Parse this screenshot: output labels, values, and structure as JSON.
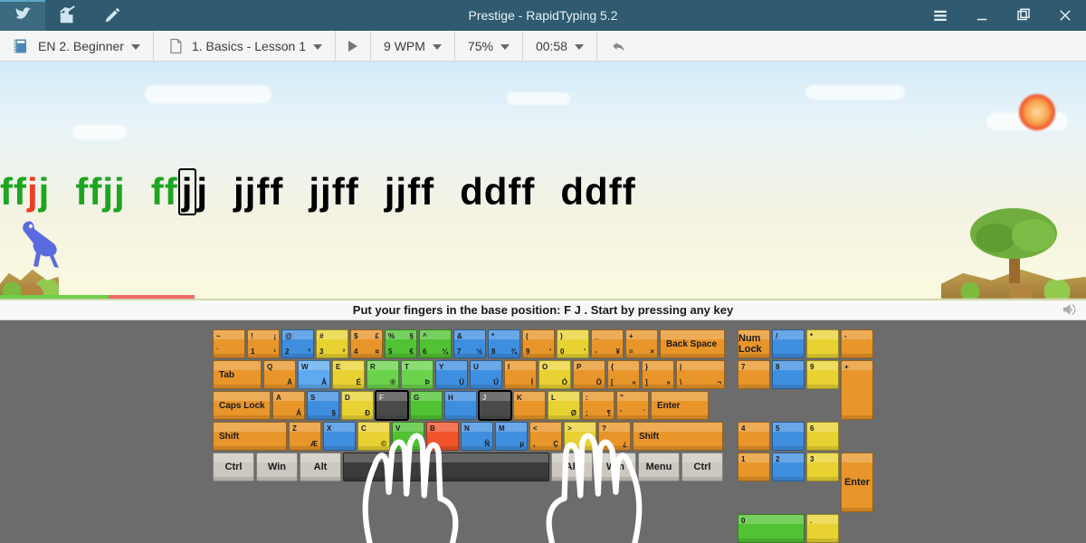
{
  "title": "Prestige - RapidTyping 5.2",
  "toolbar": {
    "course": "EN 2. Beginner",
    "lesson": "1. Basics - Lesson 1",
    "wpm": "9 WPM",
    "accuracy": "75%",
    "time": "00:58"
  },
  "typing": {
    "words": [
      {
        "chars": [
          {
            "c": "f",
            "s": "g"
          },
          {
            "c": "f",
            "s": "g"
          },
          {
            "c": "j",
            "s": "r"
          },
          {
            "c": "j",
            "s": "g"
          }
        ]
      },
      {
        "chars": [
          {
            "c": "f",
            "s": "g"
          },
          {
            "c": "f",
            "s": "g"
          },
          {
            "c": "j",
            "s": "g"
          },
          {
            "c": "j",
            "s": "g"
          }
        ]
      },
      {
        "chars": [
          {
            "c": "f",
            "s": "g"
          },
          {
            "c": "f",
            "s": "g"
          },
          {
            "c": "j",
            "s": "cur"
          },
          {
            "c": "j",
            "s": "k"
          }
        ]
      },
      {
        "chars": [
          {
            "c": "j",
            "s": "k"
          },
          {
            "c": "j",
            "s": "k"
          },
          {
            "c": "f",
            "s": "k"
          },
          {
            "c": "f",
            "s": "k"
          }
        ]
      },
      {
        "chars": [
          {
            "c": "j",
            "s": "k"
          },
          {
            "c": "j",
            "s": "k"
          },
          {
            "c": "f",
            "s": "k"
          },
          {
            "c": "f",
            "s": "k"
          }
        ]
      },
      {
        "chars": [
          {
            "c": "j",
            "s": "k"
          },
          {
            "c": "j",
            "s": "k"
          },
          {
            "c": "f",
            "s": "k"
          },
          {
            "c": "f",
            "s": "k"
          }
        ]
      },
      {
        "chars": [
          {
            "c": "d",
            "s": "k"
          },
          {
            "c": "d",
            "s": "k"
          },
          {
            "c": "f",
            "s": "k"
          },
          {
            "c": "f",
            "s": "k"
          }
        ]
      },
      {
        "chars": [
          {
            "c": "d",
            "s": "k"
          },
          {
            "c": "d",
            "s": "k"
          },
          {
            "c": "f",
            "s": "k"
          },
          {
            "c": "f",
            "s": "k"
          }
        ]
      }
    ]
  },
  "hint": "Put your fingers in the base position:  F  J .  Start by pressing any key",
  "keyboard": {
    "row0": [
      {
        "tl": "~",
        "bl": "`",
        "c": "o",
        "w": ""
      },
      {
        "tl": "!",
        "bl": "1",
        "tr": "¡",
        "br": "¹",
        "c": "o"
      },
      {
        "tl": "@",
        "bl": "2",
        "tr": "",
        "br": "²",
        "c": "b"
      },
      {
        "tl": "#",
        "bl": "3",
        "tr": "",
        "br": "³",
        "c": "y"
      },
      {
        "tl": "$",
        "bl": "4",
        "tr": "£",
        "br": "¤",
        "c": "o"
      },
      {
        "tl": "%",
        "bl": "5",
        "tr": "§",
        "br": "€",
        "c": "g"
      },
      {
        "tl": "^",
        "bl": "6",
        "tr": "",
        "br": "¼",
        "c": "g"
      },
      {
        "tl": "&",
        "bl": "7",
        "tr": "",
        "br": "½",
        "c": "b"
      },
      {
        "tl": "*",
        "bl": "8",
        "tr": "",
        "br": "¾",
        "c": "b"
      },
      {
        "tl": "(",
        "bl": "9",
        "tr": "",
        "br": "'",
        "c": "o"
      },
      {
        "tl": ")",
        "bl": "0",
        "tr": "",
        "br": "'",
        "c": "y"
      },
      {
        "tl": "_",
        "bl": "-",
        "tr": "",
        "br": "¥",
        "c": "o"
      },
      {
        "tl": "+",
        "bl": "=",
        "tr": "",
        "br": "×",
        "c": "o"
      },
      {
        "lbl": "Back Space",
        "c": "o",
        "w": "wide"
      }
    ],
    "row1": [
      {
        "lbl": "Tab",
        "c": "o",
        "w": "wtab"
      },
      {
        "tl": "Q",
        "br": "Ä",
        "c": "o"
      },
      {
        "tl": "W",
        "br": "Å",
        "c": "b2"
      },
      {
        "tl": "E",
        "br": "É",
        "c": "y"
      },
      {
        "tl": "R",
        "br": "®",
        "c": "g2"
      },
      {
        "tl": "T",
        "br": "Þ",
        "c": "g2"
      },
      {
        "tl": "Y",
        "br": "Ü",
        "c": "b"
      },
      {
        "tl": "U",
        "br": "Ú",
        "c": "b"
      },
      {
        "tl": "I",
        "br": "Í",
        "c": "o"
      },
      {
        "tl": "O",
        "br": "Ó",
        "c": "y"
      },
      {
        "tl": "P",
        "br": "Ö",
        "c": "o"
      },
      {
        "tl": "{",
        "bl": "[",
        "br": "«",
        "c": "o"
      },
      {
        "tl": "}",
        "bl": "]",
        "br": "»",
        "c": "o"
      },
      {
        "tl": "|",
        "bl": "\\",
        "br": "¬",
        "c": "o",
        "w": "wtab"
      }
    ],
    "row2": [
      {
        "lbl": "Caps Lock",
        "c": "o",
        "w": "wcaps"
      },
      {
        "tl": "A",
        "br": "Á",
        "c": "o"
      },
      {
        "tl": "S",
        "br": "§",
        "c": "b"
      },
      {
        "tl": "D",
        "br": "Ð",
        "c": "y"
      },
      {
        "tl": "F",
        "br": "",
        "c": "dk",
        "hl": true
      },
      {
        "tl": "G",
        "br": "",
        "c": "g"
      },
      {
        "tl": "H",
        "br": "",
        "c": "b"
      },
      {
        "tl": "J",
        "br": "",
        "c": "dk",
        "hl": true
      },
      {
        "tl": "K",
        "br": "",
        "c": "o"
      },
      {
        "tl": "L",
        "br": "Ø",
        "c": "y"
      },
      {
        "tl": ":",
        "bl": ";",
        "br": "¶",
        "c": "o"
      },
      {
        "tl": "\"",
        "bl": "'",
        "br": "´",
        "c": "o"
      },
      {
        "lbl": "Enter",
        "c": "o",
        "w": "went"
      }
    ],
    "row3": [
      {
        "lbl": "Shift",
        "c": "o",
        "w": "wshift"
      },
      {
        "tl": "Z",
        "br": "Æ",
        "c": "o"
      },
      {
        "tl": "X",
        "br": "",
        "c": "b"
      },
      {
        "tl": "C",
        "br": "©",
        "c": "y"
      },
      {
        "tl": "V",
        "br": "",
        "c": "g"
      },
      {
        "tl": "B",
        "br": "",
        "c": "r"
      },
      {
        "tl": "N",
        "br": "Ñ",
        "c": "b"
      },
      {
        "tl": "M",
        "br": "µ",
        "c": "b"
      },
      {
        "tl": "<",
        "bl": ",",
        "br": "Ç",
        "c": "o"
      },
      {
        "tl": ">",
        "bl": ".",
        "br": "",
        "c": "y"
      },
      {
        "tl": "?",
        "bl": "/",
        "br": "¿",
        "c": "o"
      },
      {
        "lbl": "Shift",
        "c": "o",
        "w": "wshiftR"
      }
    ],
    "row4": [
      {
        "lbl": "Ctrl",
        "c": "gy"
      },
      {
        "lbl": "Win",
        "c": "gy"
      },
      {
        "lbl": "Alt",
        "c": "gy"
      },
      {
        "lbl": "",
        "c": "sp",
        "w": "wspace"
      },
      {
        "lbl": "Alt",
        "c": "gy"
      },
      {
        "lbl": "Win",
        "c": "gy"
      },
      {
        "lbl": "Menu",
        "c": "gy"
      },
      {
        "lbl": "Ctrl",
        "c": "gy"
      }
    ],
    "num": [
      [
        {
          "lbl": "Num Lock",
          "c": "o"
        },
        {
          "tl": "/",
          "c": "b"
        },
        {
          "tl": "*",
          "c": "y"
        },
        {
          "tl": "-",
          "c": "o"
        }
      ],
      [
        {
          "tl": "7",
          "c": "o"
        },
        {
          "tl": "8",
          "c": "b"
        },
        {
          "tl": "9",
          "c": "y"
        },
        {
          "tl": "+",
          "c": "o",
          "tall": true
        }
      ],
      [
        {
          "tl": "4",
          "c": "o"
        },
        {
          "tl": "5",
          "c": "b"
        },
        {
          "tl": "6",
          "c": "y"
        }
      ],
      [
        {
          "tl": "1",
          "c": "o"
        },
        {
          "tl": "2",
          "c": "b"
        },
        {
          "tl": "3",
          "c": "y"
        },
        {
          "lbl": "Enter",
          "c": "o",
          "tall": true
        }
      ],
      [
        {
          "tl": "0",
          "c": "g",
          "w": "wide"
        },
        {
          "tl": ".",
          "c": "y"
        }
      ]
    ]
  }
}
